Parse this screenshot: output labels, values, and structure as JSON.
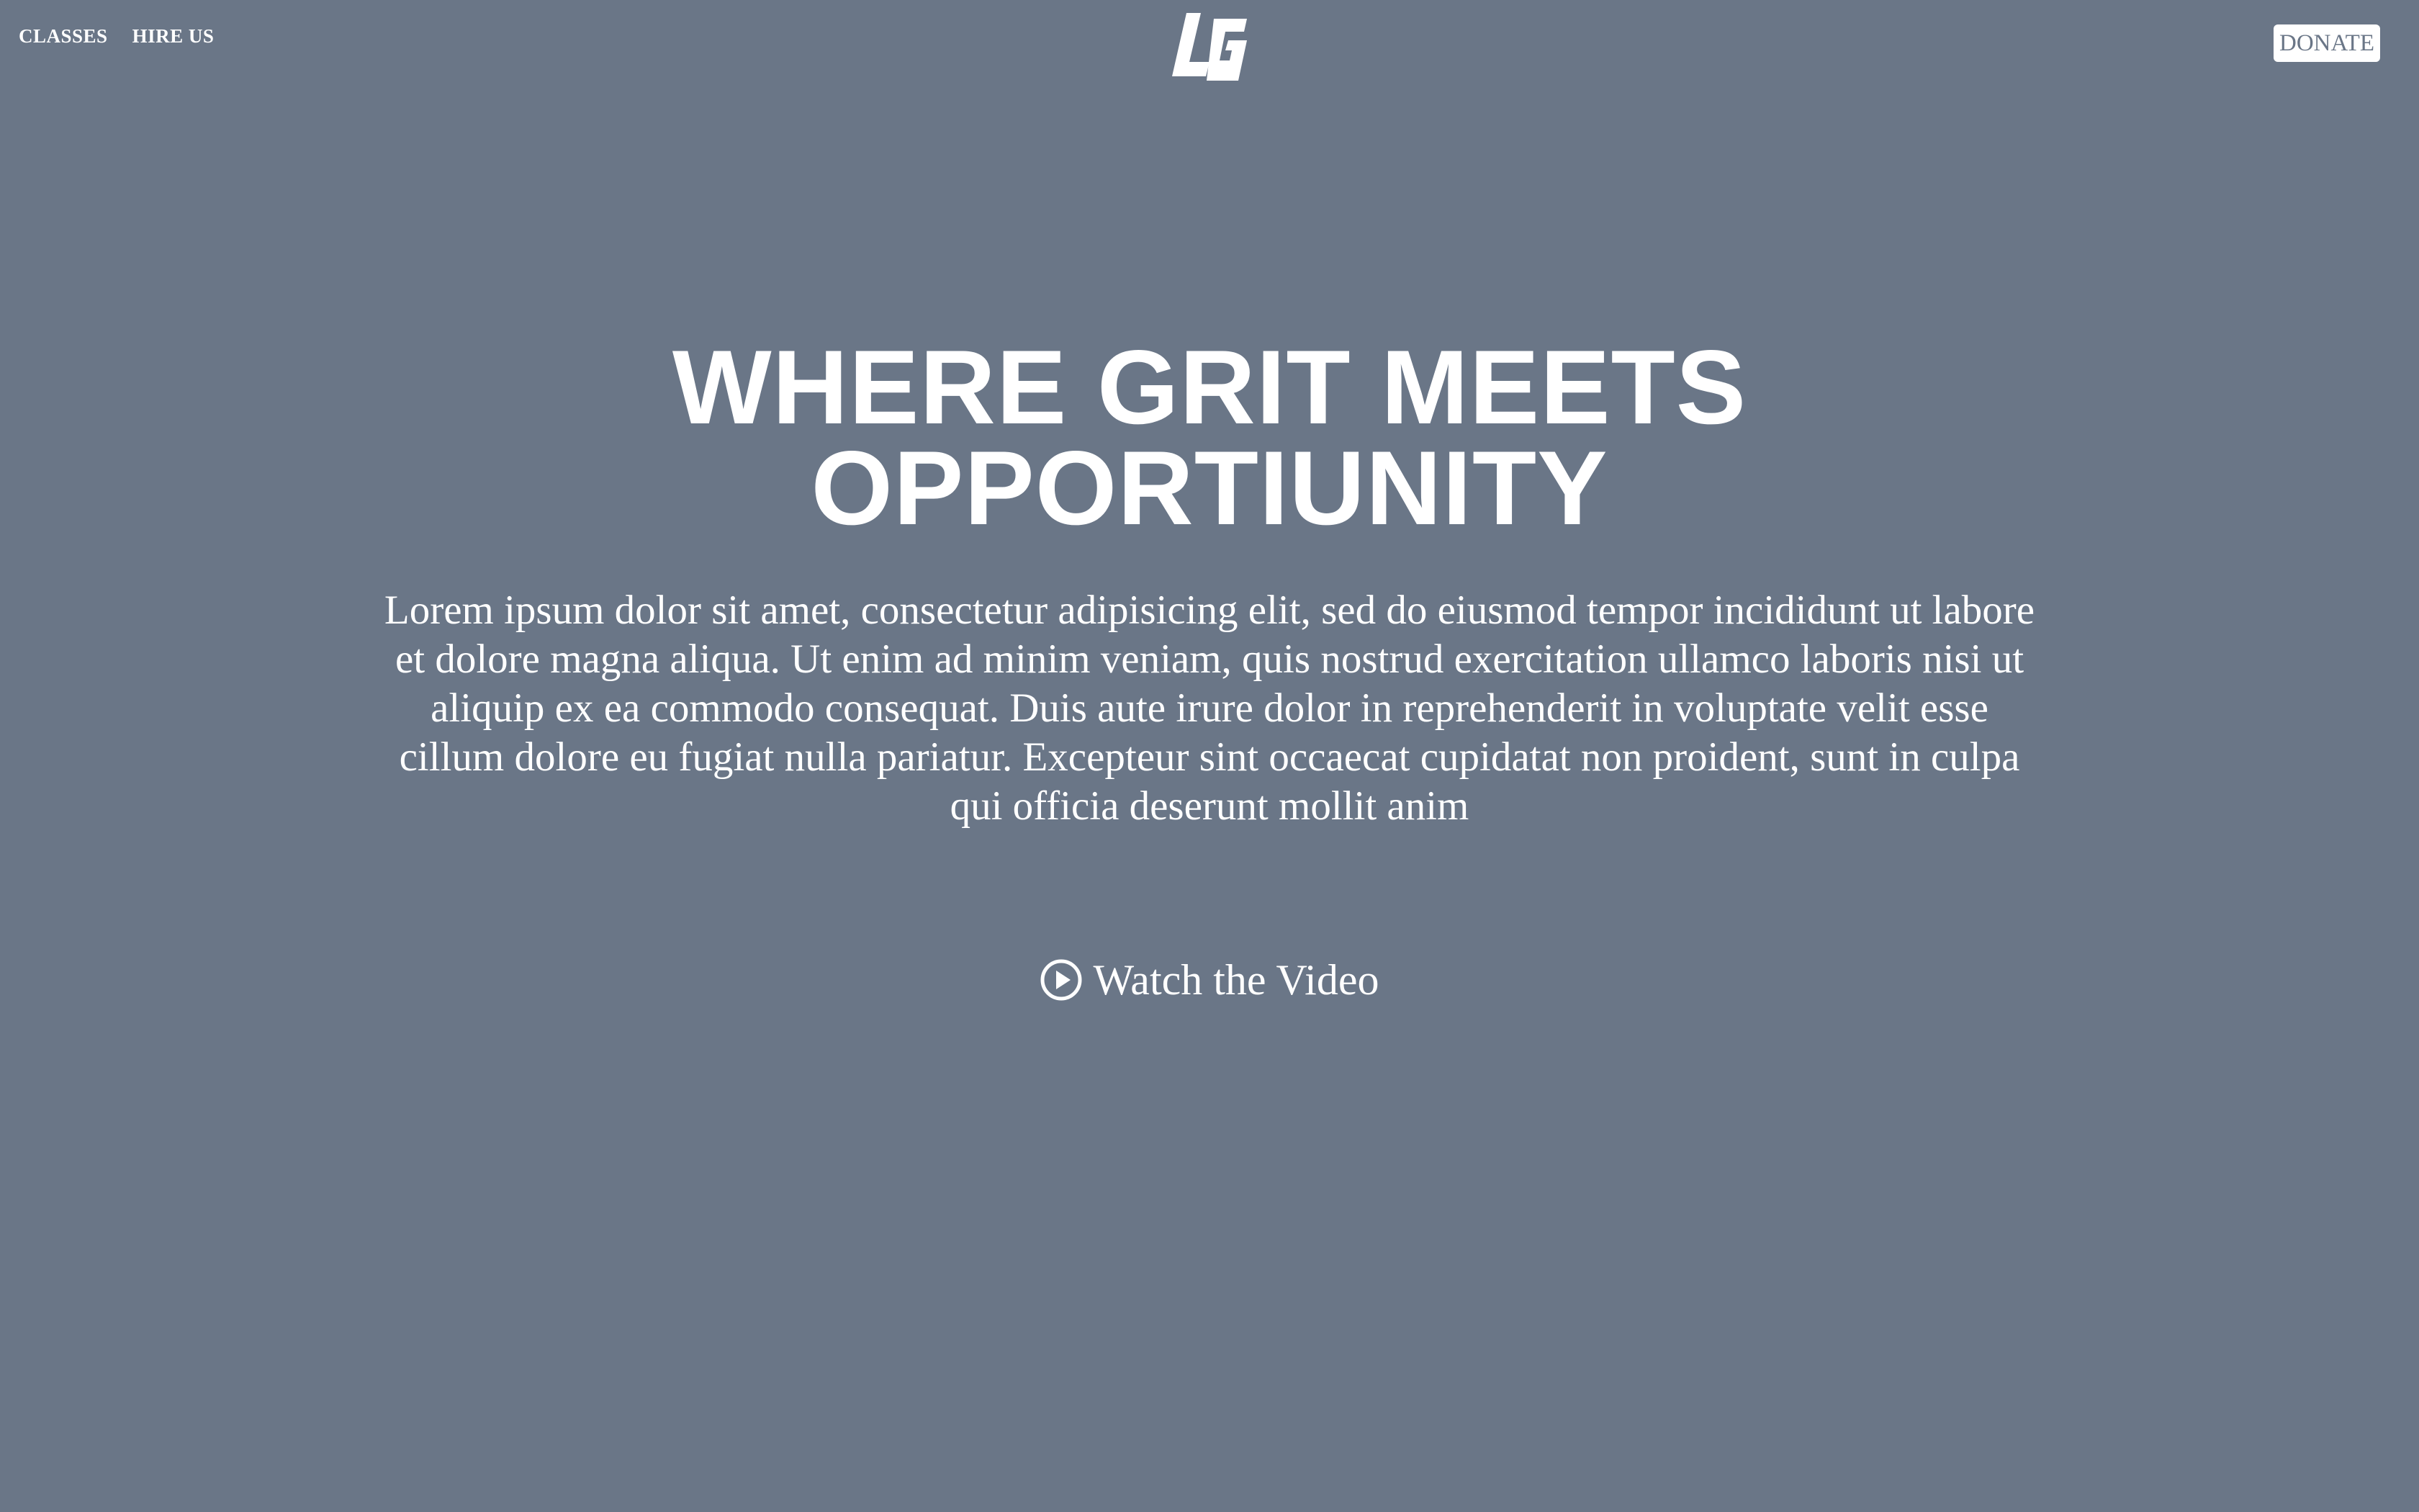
{
  "nav": {
    "links": [
      {
        "label": "CLASSES"
      },
      {
        "label": "HIRE US"
      }
    ],
    "logo_icon": "lg-monogram-logo",
    "donate_label": "DONATE"
  },
  "hero": {
    "title_line_1": "WHERE GRIT MEETS",
    "title_line_2": "OPPORTIUNITY",
    "body": "Lorem ipsum dolor sit amet, consectetur adipisicing elit, sed do eiusmod tempor incididunt ut labore et dolore magna aliqua. Ut enim ad minim veniam, quis nostrud exercitation ullamco laboris nisi ut aliquip ex ea commodo consequat. Duis aute irure dolor in reprehenderit in voluptate velit esse cillum dolore eu fugiat nulla pariatur. Excepteur sint occaecat cupidatat non proident, sunt in culpa qui officia deserunt mollit anim",
    "video_label": "Watch the Video",
    "video_icon": "play-circle-icon"
  },
  "colors": {
    "background": "#6a7687",
    "text": "#ffffff",
    "donate_text": "#6a7687"
  }
}
